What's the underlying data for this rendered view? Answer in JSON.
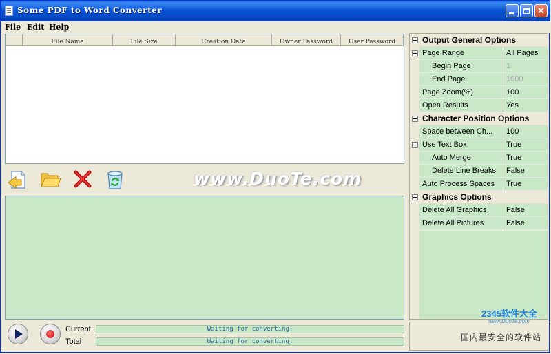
{
  "window": {
    "title": "Some PDF to Word Converter"
  },
  "menu": {
    "items": [
      "File",
      "Edit",
      "Help"
    ]
  },
  "table": {
    "columns": [
      "",
      "File Name",
      "File Size",
      "Creation Date",
      "Owner Password",
      "User Password"
    ]
  },
  "toolbar": {
    "tools": [
      {
        "name": "add-file-icon"
      },
      {
        "name": "open-folder-icon"
      },
      {
        "name": "delete-icon"
      },
      {
        "name": "recycle-bin-icon"
      }
    ]
  },
  "watermark": "www.DuoTe.com",
  "progress": {
    "current_label": "Current",
    "total_label": "Total",
    "current_status": "Waiting for converting.",
    "total_status": "Waiting for converting."
  },
  "options": [
    {
      "type": "category",
      "label": "Output General Options"
    },
    {
      "type": "property",
      "name": "Page Range",
      "value": "All Pages",
      "indent": 0,
      "expander": true
    },
    {
      "type": "property",
      "name": "Begin Page",
      "value": "1",
      "indent": 1,
      "disabled": true
    },
    {
      "type": "property",
      "name": "End Page",
      "value": "1000",
      "indent": 1,
      "disabled": true
    },
    {
      "type": "property",
      "name": "Page Zoom(%)",
      "value": "100",
      "indent": 0
    },
    {
      "type": "property",
      "name": "Open Results",
      "value": "Yes",
      "indent": 0
    },
    {
      "type": "category",
      "label": "Character Position Options"
    },
    {
      "type": "property",
      "name": "Space between Ch...",
      "value": "100",
      "indent": 0
    },
    {
      "type": "property",
      "name": "Use Text Box",
      "value": "True",
      "indent": 0,
      "expander": true
    },
    {
      "type": "property",
      "name": "Auto Merge",
      "value": "True",
      "indent": 1
    },
    {
      "type": "property",
      "name": "Delete Line Breaks",
      "value": "False",
      "indent": 1
    },
    {
      "type": "property",
      "name": "Auto Process Spaces",
      "value": "True",
      "indent": 0
    },
    {
      "type": "category",
      "label": "Graphics Options"
    },
    {
      "type": "property",
      "name": "Delete All Graphics",
      "value": "False",
      "indent": 0
    },
    {
      "type": "property",
      "name": "Delete All Pictures",
      "value": "False",
      "indent": 0
    }
  ],
  "logo": {
    "brand": "2345软件大全",
    "url": "www.DuoTe.com",
    "slogan": "国内最安全的软件站"
  }
}
